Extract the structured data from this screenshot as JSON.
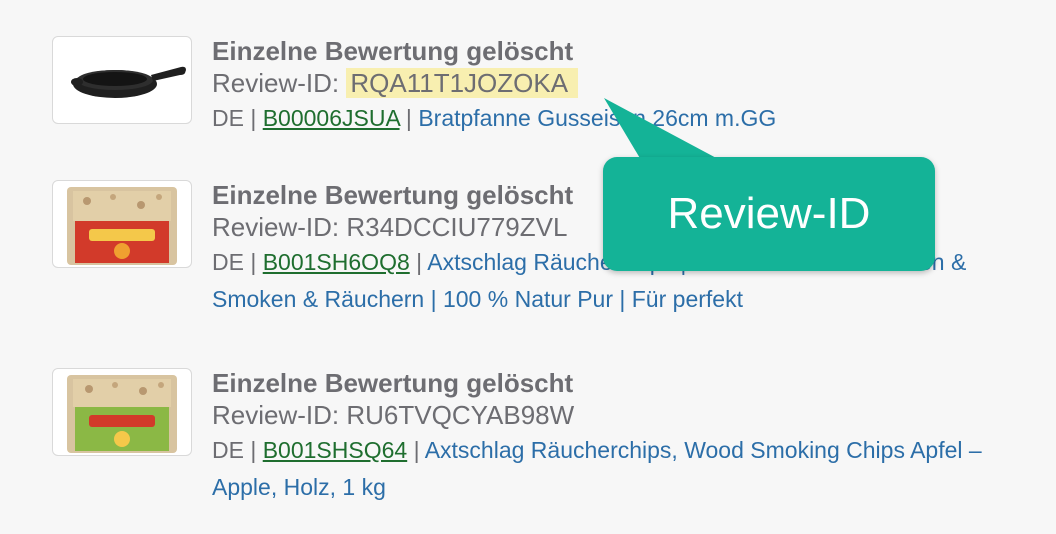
{
  "items": [
    {
      "title": "Einzelne Bewertung gelöscht",
      "review_prefix": "Review-ID: ",
      "review_id": "RQA11T1JOZOKA",
      "country": "DE",
      "separator": " | ",
      "asin": "B00006JSUA",
      "product": "Bratpfanne Gusseisen 26cm m.GG",
      "image": "cast-iron-pan"
    },
    {
      "title": "Einzelne Bewertung gelöscht",
      "review_prefix": "Review-ID: ",
      "review_id": "R34DCCIU779ZVL",
      "country": "DE",
      "separator": " | ",
      "asin": "B001SH6OQ8",
      "product": "Axtschlag Räucherchips | Räucherholz zum Grillen & Smoken & Räuchern | 100 % Natur Pur | Für perfekt",
      "image": "smoking-chips-red-bag"
    },
    {
      "title": "Einzelne Bewertung gelöscht",
      "review_prefix": "Review-ID: ",
      "review_id": "RU6TVQCYAB98W",
      "country": "DE",
      "separator": " | ",
      "asin": "B001SHSQ64",
      "product": "Axtschlag Räucherchips, Wood Smoking Chips Apfel – Apple, Holz, 1 kg",
      "image": "smoking-chips-green-bag"
    }
  ],
  "callout": {
    "label": "Review-ID",
    "color": "#14b397"
  },
  "colors": {
    "title": "#6d6d72",
    "asin_link": "#1f6e2f",
    "product_link": "#2c6ea8",
    "highlight": "#f8efb0"
  }
}
